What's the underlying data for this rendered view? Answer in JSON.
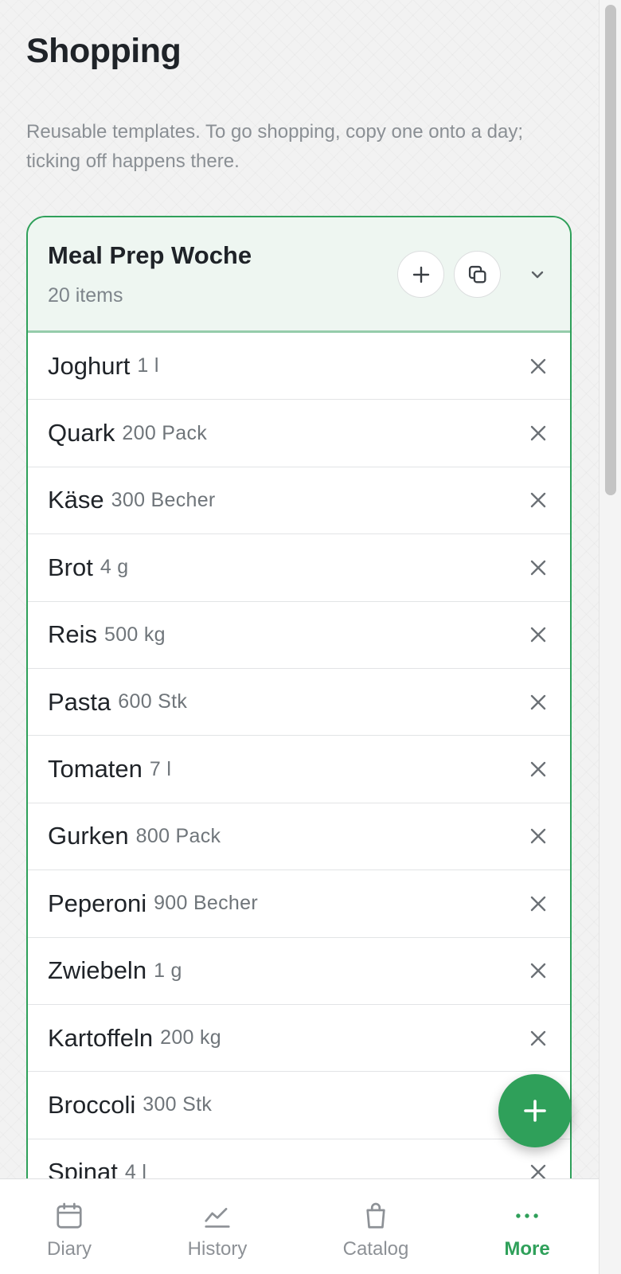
{
  "header": {
    "title": "Shopping",
    "subtitle": "Reusable templates. To go shopping, copy one onto a day; ticking off happens there."
  },
  "template": {
    "name": "Meal Prep Woche",
    "count_label": "20 items",
    "items": [
      {
        "name": "Joghurt",
        "qty": "1 l"
      },
      {
        "name": "Quark",
        "qty": "200 Pack"
      },
      {
        "name": "Käse",
        "qty": "300 Becher"
      },
      {
        "name": "Brot",
        "qty": "4 g"
      },
      {
        "name": "Reis",
        "qty": "500 kg"
      },
      {
        "name": "Pasta",
        "qty": "600 Stk"
      },
      {
        "name": "Tomaten",
        "qty": "7 l"
      },
      {
        "name": "Gurken",
        "qty": "800 Pack"
      },
      {
        "name": "Peperoni",
        "qty": "900 Becher"
      },
      {
        "name": "Zwiebeln",
        "qty": "1 g"
      },
      {
        "name": "Kartoffeln",
        "qty": "200 kg"
      },
      {
        "name": "Broccoli",
        "qty": "300 Stk"
      },
      {
        "name": "Spinat",
        "qty": "4 l"
      }
    ]
  },
  "nav": {
    "items": [
      {
        "label": "Diary",
        "icon": "calendar-icon"
      },
      {
        "label": "History",
        "icon": "chart-line-icon"
      },
      {
        "label": "Catalog",
        "icon": "shopping-bag-icon"
      },
      {
        "label": "More",
        "icon": "more-dots-icon",
        "active": true
      }
    ]
  },
  "colors": {
    "accent": "#2fa05a",
    "card_header_bg": "#eef6f1",
    "muted_text": "#8a8f94"
  }
}
